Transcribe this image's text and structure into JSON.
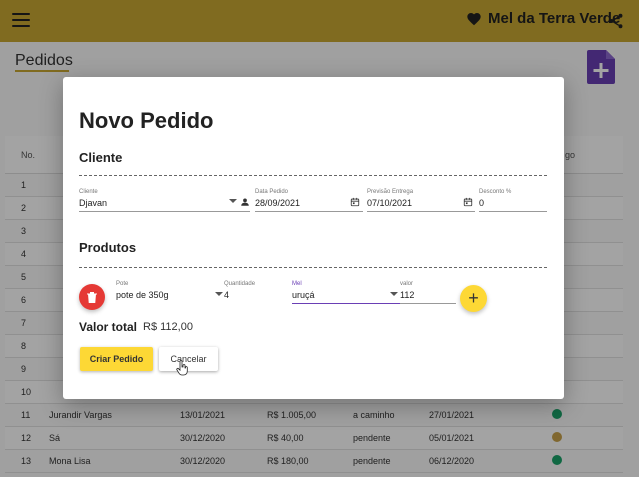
{
  "appbar": {
    "brand": "Mel da Terra Verde"
  },
  "page": {
    "title": "Pedidos"
  },
  "table": {
    "header": {
      "no": "No.",
      "tail": "go"
    },
    "rows": [
      {
        "no": "1"
      },
      {
        "no": "2"
      },
      {
        "no": "3"
      },
      {
        "no": "4"
      },
      {
        "no": "5"
      },
      {
        "no": "6"
      },
      {
        "no": "7"
      },
      {
        "no": "8"
      },
      {
        "no": "9"
      },
      {
        "no": "10"
      },
      {
        "no": "11",
        "cliente": "Jurandir Vargas",
        "data": "13/01/2021",
        "valor": "R$ 1.005,00",
        "status": "a caminho",
        "previsao": "27/01/2021",
        "dot_color": "#1aa36a"
      },
      {
        "no": "12",
        "cliente": "Sá",
        "data": "30/12/2020",
        "valor": "R$ 40,00",
        "status": "pendente",
        "previsao": "05/01/2021",
        "dot_color": "#c8a24a"
      },
      {
        "no": "13",
        "cliente": "Mona Lisa",
        "data": "30/12/2020",
        "valor": "R$ 180,00",
        "status": "pendente",
        "previsao": "06/12/2020",
        "dot_color": "#1aa36a"
      }
    ]
  },
  "dialog": {
    "title": "Novo Pedido",
    "cliente_section": "Cliente",
    "cliente": {
      "label": "Cliente",
      "value": "Djavan"
    },
    "data_pedido": {
      "label": "Data Pedido",
      "value": "28/09/2021"
    },
    "previsao": {
      "label": "Previsão Entrega",
      "value": "07/10/2021"
    },
    "desconto": {
      "label": "Desconto %",
      "value": "0"
    },
    "produtos_section": "Produtos",
    "pote": {
      "label": "Pote",
      "value": "pote de 350g"
    },
    "quantidade": {
      "label": "Quantidade",
      "value": "4"
    },
    "mel": {
      "label": "Mel",
      "value": "uruçá"
    },
    "valor": {
      "label": "valor",
      "value": "112"
    },
    "total_label": "Valor total",
    "total_value": "R$ 112,00",
    "criar_label": "Criar Pedido",
    "cancelar_label": "Cancelar"
  },
  "colors": {
    "appbar": "#c9a832",
    "accent": "#fdd835",
    "delete": "#e53935",
    "add_doc": "#6a3fb5",
    "mel_underline": "#6a3fb5"
  }
}
